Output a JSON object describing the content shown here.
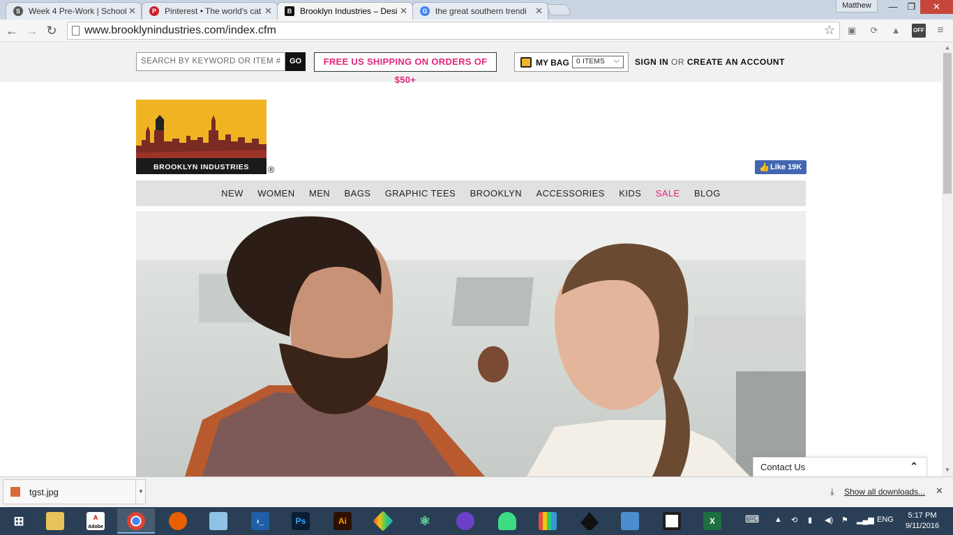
{
  "browser": {
    "tabs": [
      {
        "title": "Week 4 Pre-Work | School",
        "favicon": "S"
      },
      {
        "title": "Pinterest • The world's cat",
        "favicon": "P"
      },
      {
        "title": "Brooklyn Industries – Desi",
        "favicon": "B"
      },
      {
        "title": "the great southern trendi",
        "favicon": "G"
      }
    ],
    "profile": "Matthew",
    "url": "www.brooklynindustries.com/index.cfm",
    "ext_off_label": "OFF"
  },
  "site": {
    "search_placeholder": "SEARCH BY KEYWORD OR ITEM #",
    "go_label": "GO",
    "shipping_promo": "FREE US SHIPPING ON ORDERS OF $50+",
    "bag_label": "MY BAG",
    "bag_items": "0 ITEMS",
    "sign_in": "SIGN IN",
    "or": "OR",
    "create_account": "CREATE AN ACCOUNT",
    "logo_text": "BROOKLYN INDUSTRIES",
    "registered": "®",
    "fb_like": "Like 19K",
    "nav": [
      "NEW",
      "WOMEN",
      "MEN",
      "BAGS",
      "GRAPHIC TEES",
      "BROOKLYN",
      "ACCESSORIES",
      "KIDS",
      "SALE",
      "BLOG"
    ],
    "contact": "Contact Us",
    "accent_color": "#e0267a"
  },
  "downloads": {
    "file": "tgst.jpg",
    "show_all": "Show all downloads..."
  },
  "taskbar": {
    "apps": [
      "Windows",
      "File Explorer",
      "Adobe",
      "Chrome",
      "Firefox",
      "Notes",
      "PowerShell",
      "Photoshop",
      "Illustrator",
      "Sketch",
      "Atom",
      "GitHub",
      "Android",
      "Apps",
      "Inkscape",
      "Remote",
      "Desktop",
      "Excel"
    ],
    "adobe_label": "Adobe",
    "language": "ENG",
    "time": "5:17 PM",
    "date": "9/11/2016"
  }
}
